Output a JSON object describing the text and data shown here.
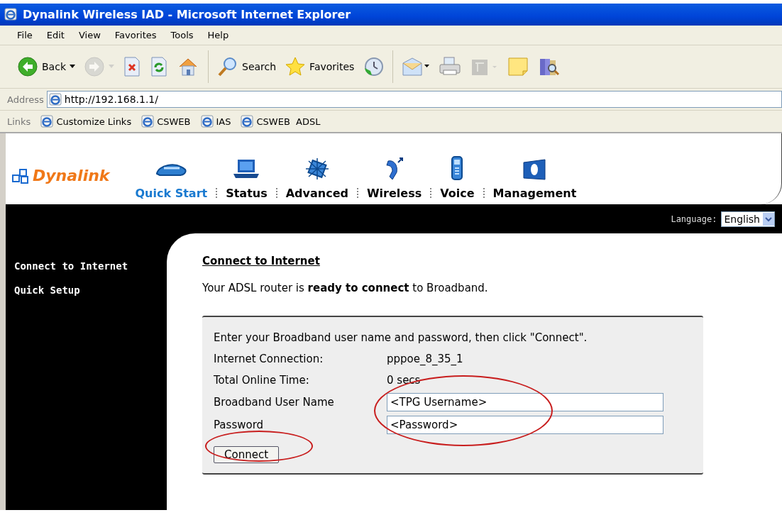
{
  "window": {
    "title": "Dynalink Wireless IAD - Microsoft Internet Explorer"
  },
  "menu": [
    "File",
    "Edit",
    "View",
    "Favorites",
    "Tools",
    "Help"
  ],
  "toolbar": [
    {
      "kind": "back",
      "label": "Back",
      "disabled": false
    },
    {
      "kind": "forward",
      "disabled": true
    },
    {
      "kind": "stop",
      "disabled": false
    },
    {
      "kind": "refresh",
      "disabled": false
    },
    {
      "kind": "home",
      "disabled": false
    },
    {
      "kind": "search",
      "label": "Search",
      "disabled": false
    },
    {
      "kind": "favorites",
      "label": "Favorites",
      "disabled": false
    },
    {
      "kind": "history",
      "disabled": false
    },
    {
      "kind": "mail",
      "disabled": false
    },
    {
      "kind": "print",
      "disabled": false
    },
    {
      "kind": "edit",
      "disabled": true
    },
    {
      "kind": "note",
      "disabled": false
    },
    {
      "kind": "research",
      "disabled": false
    }
  ],
  "address": {
    "label": "Address",
    "url": "http://192.168.1.1/"
  },
  "links": {
    "label": "Links",
    "items": [
      "Customize Links",
      "CSWEB",
      "IAS",
      "CSWEB  ADSL"
    ]
  },
  "router": {
    "brand": "Dynalink",
    "nav": [
      {
        "kind": "quickstart",
        "label": "Quick Start",
        "selected": true
      },
      {
        "kind": "status",
        "label": "Status",
        "selected": false
      },
      {
        "kind": "advanced",
        "label": "Advanced",
        "selected": false
      },
      {
        "kind": "wireless",
        "label": "Wireless",
        "selected": false
      },
      {
        "kind": "voice",
        "label": "Voice",
        "selected": false
      },
      {
        "kind": "management",
        "label": "Management",
        "selected": false
      }
    ],
    "language": {
      "label": "Language:",
      "value": "English"
    },
    "sidebar": [
      "Connect to Internet",
      "Quick Setup"
    ],
    "heading": "Connect to Internet",
    "intro": "Your ADSL router is **ready to connect** to Broadband.",
    "panel": {
      "instructions": "Enter your Broadband user name and password, then click \"Connect\".",
      "info": [
        {
          "label": "Internet Connection:",
          "value": "pppoe_8_35_1"
        },
        {
          "label": "Total Online Time:",
          "value": "0 secs"
        }
      ],
      "fields": [
        {
          "label": "Broadband User Name",
          "value": "<TPG Username>"
        },
        {
          "label": "Password",
          "value": "<Password>"
        }
      ],
      "fields_circled": true,
      "button": {
        "label": "Connect",
        "circled": true
      }
    }
  }
}
